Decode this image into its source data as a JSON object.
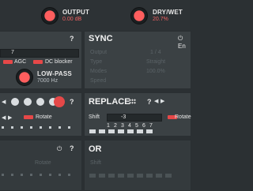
{
  "output": {
    "label": "OUTPUT",
    "value": "0.00 dB"
  },
  "drywet": {
    "label": "DRY/WET",
    "value": "20.7%"
  },
  "filter": {
    "help": "?",
    "stepper_value": "7",
    "agc_label": "AGC",
    "dcblocker_label": "DC blocker",
    "lowpass_label": "LOW-PASS",
    "lowpass_freq": "7000 Hz"
  },
  "sync": {
    "title": "SYNC",
    "power_label": "En",
    "rows": [
      {
        "label": "Output",
        "value": "1 / 4"
      },
      {
        "label": "Type",
        "value": "Straight"
      },
      {
        "label": "Modes",
        "value": "100.0%"
      },
      {
        "label": "Speed",
        "value": "x1"
      }
    ]
  },
  "seq": {
    "help": "?",
    "rotate_label": "Rotate"
  },
  "replace": {
    "title": "REPLACE",
    "help": "?",
    "rotate_label": "Rotate",
    "shift_label": "Shift",
    "shift_value": "-3",
    "ticks": [
      "1",
      "2",
      "3",
      "4",
      "5",
      "6",
      "7"
    ]
  },
  "bottom_left": {
    "help": "?",
    "faint_label": "Rotate"
  },
  "or": {
    "title": "OR",
    "faint_label": "Shift"
  },
  "colors": {
    "accent": "#e64848",
    "panel": "#3b4144",
    "bg": "#2b3033"
  }
}
